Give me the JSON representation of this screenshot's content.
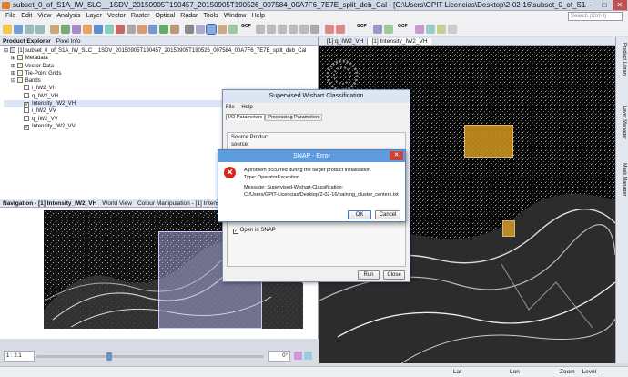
{
  "window": {
    "title": "subset_0_of_S1A_IW_SLC__1SDV_20150905T190457_20150905T190526_007584_00A7F6_7E7E_split_deb_Cal - [C:\\Users\\GPIT-Licencias\\Desktop\\2-02-16\\subset_0_of_S1A_IW_SLC__1SDV_20150905T19...",
    "minimize": "–",
    "maximize": "□",
    "close": "✕"
  },
  "menu": [
    "File",
    "Edit",
    "View",
    "Analysis",
    "Layer",
    "Vector",
    "Raster",
    "Optical",
    "Radar",
    "Tools",
    "Window",
    "Help"
  ],
  "search": {
    "placeholder": "Search (Ctrl+I)"
  },
  "toolbar": {
    "gcp1": "GCP",
    "gcp2": "GCP",
    "gcp3": "GCP"
  },
  "product_explorer": {
    "tabs": [
      "Product Explorer",
      "Pixel Info"
    ],
    "root": "[1] subset_0_of_S1A_IW_SLC__1SDV_20150905T190457_20150905T190526_007584_00A7F6_7E7E_split_deb_Cal",
    "folders": [
      "Metadata",
      "Vector Data",
      "Tie-Point Grids",
      "Bands"
    ],
    "bands": [
      "i_IW2_VH",
      "q_IW2_VH",
      "Intensity_IW2_VH",
      "i_IW2_VV",
      "q_IW2_VV",
      "Intensity_IW2_VV"
    ],
    "band_markers": [
      "",
      "",
      "V",
      "",
      "",
      "V"
    ]
  },
  "navigation": {
    "tabs": [
      "Navigation - [1] Intensity_IW2_VH",
      "World View",
      "Colour Manipulation - [1] Intensity_IW2_VH"
    ],
    "zoom": "1 : 2.1",
    "angle": "0°"
  },
  "view": {
    "tabs": [
      "[1] q_IW2_VH",
      "[1] Intensity_IW2_VH"
    ]
  },
  "sidebar": [
    "Product Library",
    "Layer Manager",
    "Mask Manager"
  ],
  "status": {
    "lat": "Lat",
    "lon": "Lon",
    "zoom": "Zoom -- Level --"
  },
  "wishart": {
    "title": "Supervised Wishart Classification",
    "menu": [
      "File",
      "Help"
    ],
    "tabs": [
      "I/O Parameters",
      "Processing Parameters"
    ],
    "source_product_label": "Source Product",
    "source_label": "source:",
    "open_in_snap": "Open in SNAP",
    "run": "Run",
    "close": "Close"
  },
  "error": {
    "title": "SNAP - Error",
    "line1": "A problem occurred during the target product initialisation.",
    "line2": "Type: OperatorException",
    "line3": "Message: Supervised-Wishart-Classification:",
    "line4": "C:/Users/GPIT-Licencias/Desktop/2-02-16/training_cluster_centers.txt",
    "ok": "OK",
    "cancel": "Cancel"
  },
  "colors": {
    "accent": "#5e9ce0",
    "error_red": "#d9261c",
    "highlight_box": "#e8b033"
  }
}
